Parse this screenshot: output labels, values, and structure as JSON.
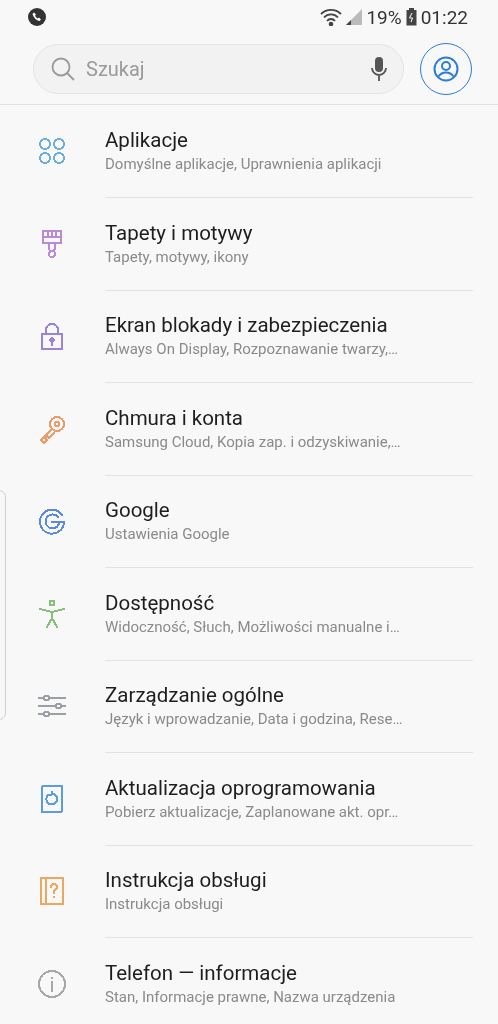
{
  "status_bar": {
    "battery": "19%",
    "time": "01:22"
  },
  "search": {
    "placeholder": "Szukaj"
  },
  "items": [
    {
      "kind": "apps",
      "color": "#6aaedc",
      "title": "Aplikacje",
      "subtitle": "Domyślne aplikacje, Uprawnienia aplikacji"
    },
    {
      "kind": "brush",
      "color": "#b98ad8",
      "title": "Tapety i motywy",
      "subtitle": "Tapety, motywy, ikony"
    },
    {
      "kind": "lock",
      "color": "#9a84d8",
      "title": "Ekran blokady i zabezpieczenia",
      "subtitle": "Always On Display, Rozpoznawanie twarzy,…"
    },
    {
      "kind": "key",
      "color": "#ec9c6a",
      "title": "Chmura i konta",
      "subtitle": "Samsung Cloud, Kopia zap. i odzyskiwanie,…"
    },
    {
      "kind": "google",
      "color": "#5a8ad8",
      "title": "Google",
      "subtitle": "Ustawienia Google"
    },
    {
      "kind": "person",
      "color": "#86c07a",
      "title": "Dostępność",
      "subtitle": "Widoczność, Słuch, Możliwości manualne i…"
    },
    {
      "kind": "sliders",
      "color": "#9aa0a6",
      "title": "Zarządzanie ogólne",
      "subtitle": "Język i wprowadzanie, Data i godzina, Rese…"
    },
    {
      "kind": "update",
      "color": "#5a9ee0",
      "title": "Aktualizacja oprogramowania",
      "subtitle": "Pobierz aktualizacje, Zaplanowane akt. opr…"
    },
    {
      "kind": "manual",
      "color": "#eaa860",
      "title": "Instrukcja obsługi",
      "subtitle": "Instrukcja obsługi"
    },
    {
      "kind": "info",
      "color": "#a8a8a8",
      "title": "Telefon — informacje",
      "subtitle": "Stan, Informacje prawne, Nazwa urządzenia"
    }
  ]
}
